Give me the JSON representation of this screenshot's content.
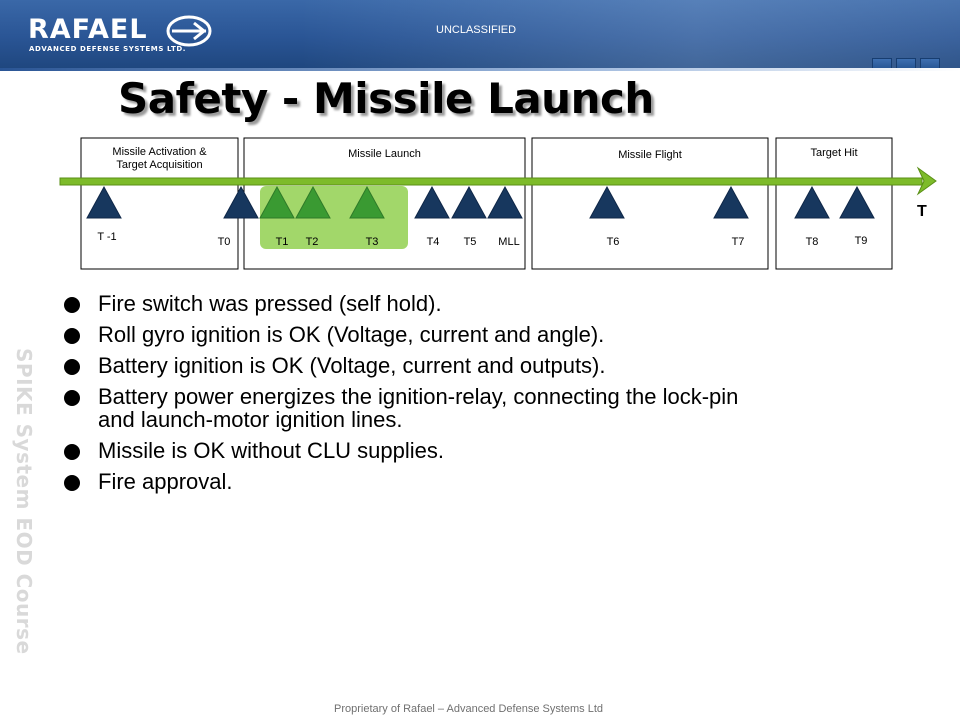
{
  "header": {
    "logo_name": "RAFAEL",
    "logo_tagline": "ADVANCED DEFENSE SYSTEMS LTD.",
    "classification": "UNCLASSIFIED",
    "colors": {
      "band": "#2a5595",
      "accent_square": "#1c4a86"
    }
  },
  "slide": {
    "title": "Safety - Missile Launch",
    "side_label": "SPIKE System EOD Course",
    "footer": "Proprietary of Rafael – Advanced Defense Systems Ltd"
  },
  "timeline": {
    "axis_label": "T",
    "colors": {
      "arrow": "#7dbb2a",
      "marker": "#17375e",
      "active_marker": "#3a9a32",
      "highlight": "#92d050"
    },
    "phases": [
      {
        "label_lines": [
          "Missile Activation &",
          "Target Acquisition"
        ]
      },
      {
        "label_lines": [
          "Missile Launch"
        ]
      },
      {
        "label_lines": [
          "Missile Flight"
        ]
      },
      {
        "label_lines": [
          "Target Hit"
        ]
      }
    ],
    "markers": [
      {
        "label": "T -1",
        "active": false
      },
      {
        "label": "T0",
        "active": false
      },
      {
        "label": "T1",
        "active": true
      },
      {
        "label": "T2",
        "active": true
      },
      {
        "label": "T3",
        "active": true
      },
      {
        "label": "T4",
        "active": false
      },
      {
        "label": "T5",
        "active": false
      },
      {
        "label": "MLL",
        "active": false
      },
      {
        "label": "T6",
        "active": false
      },
      {
        "label": "T7",
        "active": false
      },
      {
        "label": "T8",
        "active": false
      },
      {
        "label": "T9",
        "active": false
      }
    ]
  },
  "bullets": [
    {
      "lines": [
        "Fire switch was pressed (self hold)."
      ]
    },
    {
      "lines": [
        "Roll gyro ignition is OK (Voltage, current and angle)."
      ]
    },
    {
      "lines": [
        "Battery ignition is OK (Voltage, current and outputs)."
      ]
    },
    {
      "lines": [
        "Battery power energizes the ignition-relay, connecting the lock-pin",
        "and launch-motor ignition lines."
      ]
    },
    {
      "lines": [
        "Missile is OK without CLU supplies."
      ]
    },
    {
      "lines": [
        "Fire approval."
      ]
    }
  ]
}
